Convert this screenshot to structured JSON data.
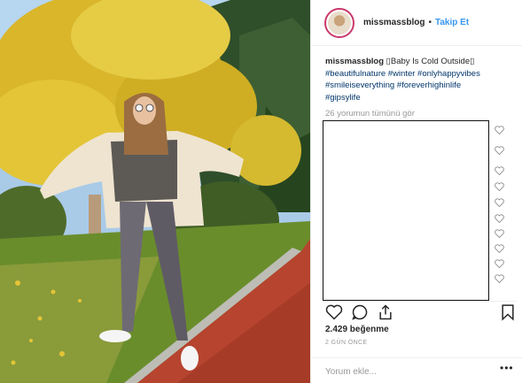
{
  "post": {
    "username": "missmassblog",
    "separator": "•",
    "follow_label": "Takip Et"
  },
  "caption": {
    "username": "missmassblog",
    "text": " ▯Baby Is Cold Outside▯",
    "hashtags_line1": "#beautifulnature #winter #onlyhappyvibes",
    "hashtags_line2": "#smileiseverything #foreverhighinlife",
    "hashtags_line3": "#gipsylife"
  },
  "comments": {
    "view_all": "26 yorumun tümünü gör"
  },
  "actions": {
    "like_icon": "heart-outline-icon",
    "comment_icon": "comment-bubble-icon",
    "share_icon": "share-icon",
    "save_icon": "bookmark-icon"
  },
  "stats": {
    "likes": "2.429 beğenme",
    "date": "2 GÜN ÖNCE"
  },
  "comment_box": {
    "placeholder": "Yorum ekle...",
    "more_label": "•••"
  },
  "colors": {
    "link_blue": "#3897f0",
    "hashtag": "#003569",
    "muted": "#999999",
    "text": "#262626"
  }
}
